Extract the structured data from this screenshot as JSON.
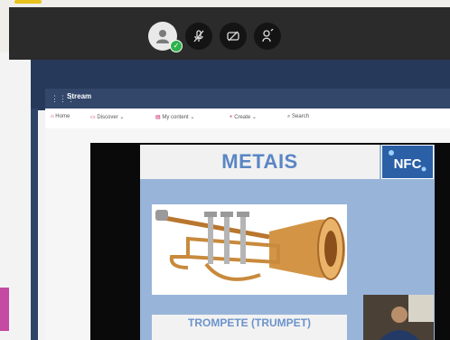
{
  "meeting_toolbar": {
    "buttons": [
      {
        "name": "avatar",
        "icon": "user-icon"
      },
      {
        "name": "microphone",
        "icon": "mic-off-icon"
      },
      {
        "name": "camera",
        "icon": "camera-off-icon"
      },
      {
        "name": "share",
        "icon": "share-icon"
      }
    ]
  },
  "stream": {
    "app_title": "Stream",
    "nav": {
      "home": "Home",
      "discover": "Discover",
      "my_content": "My content",
      "create": "Create",
      "search_placeholder": "Search"
    }
  },
  "slide": {
    "title": "METAIS",
    "logo_text": "NFC",
    "caption": "TROMPETE (TRUMPET)"
  },
  "colors": {
    "stream_navy": "#27395a",
    "slide_blue": "#98b4d9",
    "title_blue": "#5a86c4",
    "accent_pink": "#c2185b",
    "status_green": "#2eb34a"
  }
}
